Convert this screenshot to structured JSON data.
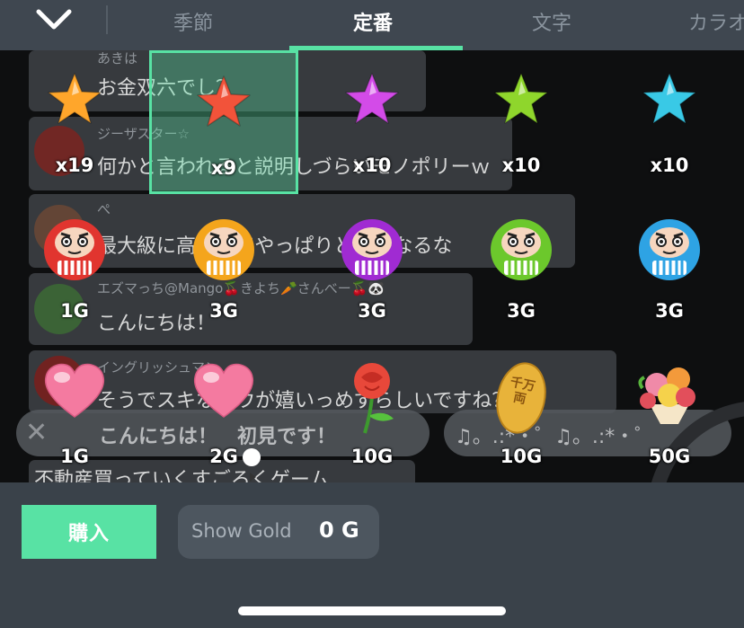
{
  "tabs": [
    {
      "label": "季節",
      "active": false
    },
    {
      "label": "定番",
      "active": true
    },
    {
      "label": "文字",
      "active": false
    },
    {
      "label": "カラオ",
      "active": false
    }
  ],
  "chat": {
    "messages": [
      {
        "name": "あきは",
        "text": "お金双六でし？"
      },
      {
        "name": "ジーザスター☆",
        "text": "何かと言われると説明しづらいモノポリーｗ"
      },
      {
        "name": "ぺ",
        "text": "最大級に高いくてやっぱりとかになるな"
      },
      {
        "name": "エズマっち@Mango🍒きよち🥕さんべー🍒🐼",
        "text": "こんにちは！"
      },
      {
        "name": "イングリッシュマン",
        "text": "そうでスキなのウが嬉いっめずらしいですね？"
      },
      {
        "name": "",
        "text": "不動産買っていくすごろくゲーム"
      }
    ],
    "comment_bar": {
      "close": "✕",
      "text": "こんにちは！　初見です！"
    },
    "music_bar": {
      "text": "♫。.:*・゜♫。.:*・゜"
    }
  },
  "gifts": [
    {
      "kind": "star",
      "color": "#ffa62b",
      "label": "x19",
      "selected": false
    },
    {
      "kind": "star",
      "color": "#f2533a",
      "label": "x9",
      "selected": true
    },
    {
      "kind": "star",
      "color": "#d34be8",
      "label": "x10",
      "selected": false
    },
    {
      "kind": "star",
      "color": "#8fd62c",
      "label": "x10",
      "selected": false
    },
    {
      "kind": "star",
      "color": "#39c9e6",
      "label": "x10",
      "selected": false
    },
    {
      "kind": "daruma",
      "color": "#e1352f",
      "label": "1G",
      "selected": false
    },
    {
      "kind": "daruma",
      "color": "#f4a51c",
      "label": "3G",
      "selected": false
    },
    {
      "kind": "daruma",
      "color": "#a02bd2",
      "label": "3G",
      "selected": false
    },
    {
      "kind": "daruma",
      "color": "#6cc82c",
      "label": "3G",
      "selected": false
    },
    {
      "kind": "daruma",
      "color": "#2ea3e4",
      "label": "3G",
      "selected": false
    },
    {
      "kind": "heart",
      "color": "#f47aa0",
      "label": "1G",
      "selected": false
    },
    {
      "kind": "heart",
      "color": "#f47aa0",
      "label": "2G",
      "selected": false,
      "play": true
    },
    {
      "kind": "rose",
      "color": "#e8483a",
      "label": "10G",
      "selected": false
    },
    {
      "kind": "koban",
      "color": "#e8b33a",
      "label": "10G",
      "selected": false,
      "text": "千万両"
    },
    {
      "kind": "bouquet",
      "color": "#f08aa8",
      "label": "50G",
      "selected": false
    }
  ],
  "bottom": {
    "buy_label": "購入",
    "gold_label": "Show Gold",
    "gold_value": "0 G"
  },
  "colors": {
    "accent": "#58e2a4",
    "bar": "#3a424a"
  }
}
